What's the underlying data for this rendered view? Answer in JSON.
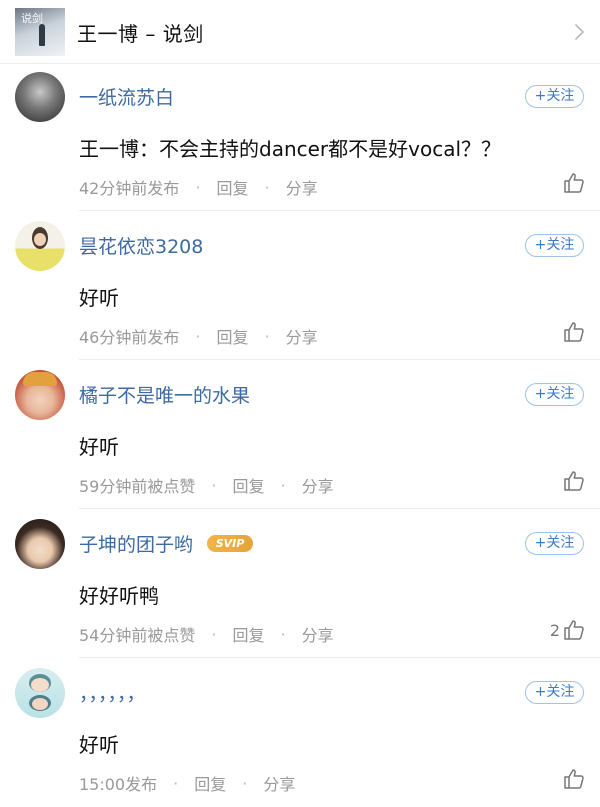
{
  "song": {
    "title": "王一博 – 说剑",
    "cover_text": "说剑"
  },
  "colors": {
    "username": "#3d6aa0",
    "follow": "#3b7cc4",
    "meta": "#999999",
    "svip_badge": "#eeae43"
  },
  "comments": [
    {
      "username": "一纸流苏白",
      "follow_label": "+关注",
      "text": "王一博：不会主持的dancer都不是好vocal？？",
      "time": "42分钟前发布",
      "reply": "回复",
      "share": "分享",
      "likes": ""
    },
    {
      "username": "昙花依恋3208",
      "follow_label": "+关注",
      "text": "好听",
      "time": "46分钟前发布",
      "reply": "回复",
      "share": "分享",
      "likes": ""
    },
    {
      "username": "橘子不是唯一的水果",
      "follow_label": "+关注",
      "text": "好听",
      "time": "59分钟前被点赞",
      "reply": "回复",
      "share": "分享",
      "likes": ""
    },
    {
      "username": "子坤的团子哟",
      "badge": "SVIP",
      "follow_label": "+关注",
      "text": "好好听鸭",
      "time": "54分钟前被点赞",
      "reply": "回复",
      "share": "分享",
      "likes": "2"
    },
    {
      "username": "，，，，，，",
      "follow_label": "+关注",
      "text": "好听",
      "time": "15:00发布",
      "reply": "回复",
      "share": "分享",
      "likes": ""
    }
  ]
}
